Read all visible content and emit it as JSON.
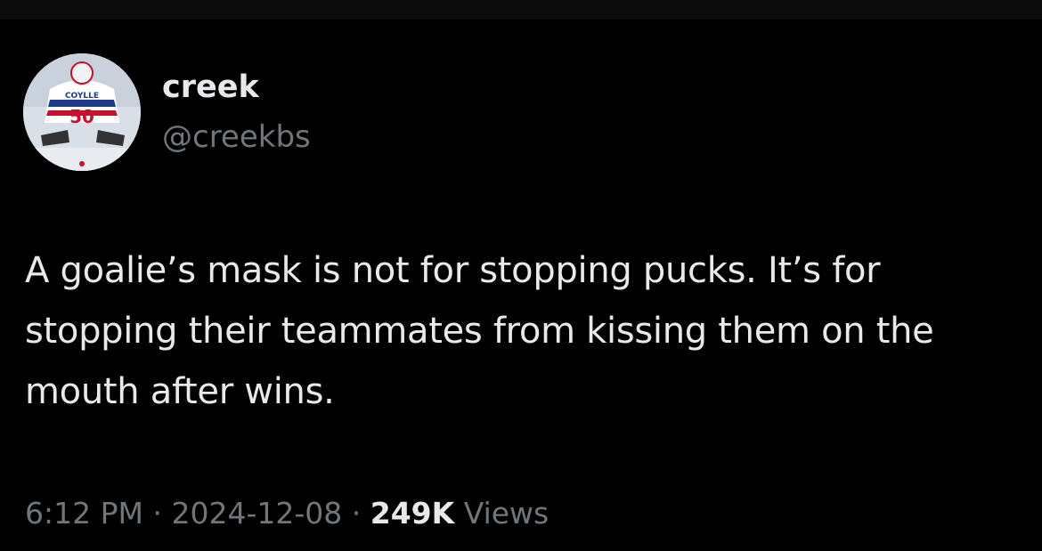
{
  "tweet": {
    "author": {
      "display_name": "creek",
      "handle": "@creekbs",
      "avatar_icon": "hockey-goalie-avatar",
      "avatar_jersey_name": "COYLLE",
      "avatar_jersey_number": "50"
    },
    "text": "A goalie’s mask is not for stopping pucks. It’s for stopping their teammates from kissing them on the mouth after wins.",
    "time": "6:12 PM",
    "separator": "·",
    "date": "2024-12-08",
    "views_count": "249K",
    "views_label": "Views"
  },
  "colors": {
    "background": "#000000",
    "primary_text": "#e7e9ea",
    "secondary_text": "#71767b"
  }
}
